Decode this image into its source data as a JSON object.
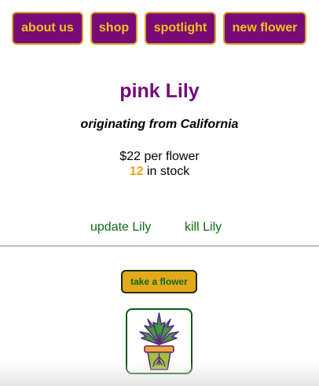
{
  "nav": {
    "items": [
      {
        "label": "about us"
      },
      {
        "label": "shop"
      },
      {
        "label": "spotlight"
      },
      {
        "label": "new flower"
      }
    ]
  },
  "flower": {
    "name": "pink Lily",
    "origin": "originating from California",
    "price_text": "$22 per flower",
    "stock_count": "12",
    "stock_suffix": " in stock"
  },
  "actions": {
    "update_label": "update Lily",
    "kill_label": "kill Lily"
  },
  "take": {
    "label": "take a flower"
  },
  "image": {
    "icon": "potted-plant-icon"
  },
  "colors": {
    "nav_bg": "#7a0a78",
    "nav_text": "#f0c418",
    "title": "#760a78",
    "link": "#0d6e12",
    "accent": "#e3a51a"
  }
}
